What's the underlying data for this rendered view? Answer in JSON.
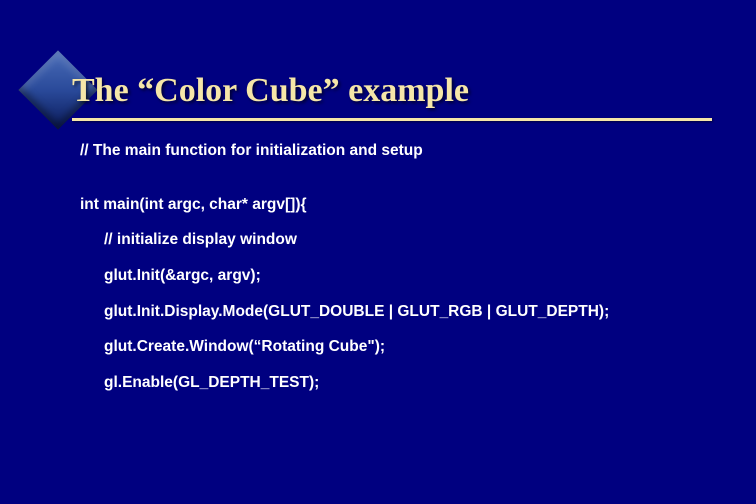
{
  "slide": {
    "title": "The “Color Cube” example",
    "lines": {
      "comment1": "// The main function for initialization and setup",
      "sig": "int main(int argc, char* argv[]){",
      "comment2": "// initialize display window",
      "l1": "glut.Init(&argc, argv);",
      "l2": "glut.Init.Display.Mode(GLUT_DOUBLE | GLUT_RGB | GLUT_DEPTH);",
      "l3": "glut.Create.Window(“Rotating Cube\");",
      "l4": "gl.Enable(GL_DEPTH_TEST);"
    }
  }
}
